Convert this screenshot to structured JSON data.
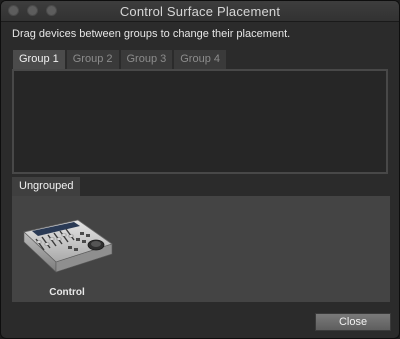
{
  "window": {
    "title": "Control Surface Placement"
  },
  "instruction": "Drag devices between groups to change their placement.",
  "tabs": [
    {
      "label": "Group 1",
      "active": true
    },
    {
      "label": "Group 2",
      "active": false
    },
    {
      "label": "Group 3",
      "active": false
    },
    {
      "label": "Group 4",
      "active": false
    }
  ],
  "ungrouped": {
    "label": "Ungrouped",
    "devices": [
      {
        "label": "Control",
        "icon": "mixing-console-icon"
      }
    ]
  },
  "buttons": {
    "close_label": "Close"
  }
}
